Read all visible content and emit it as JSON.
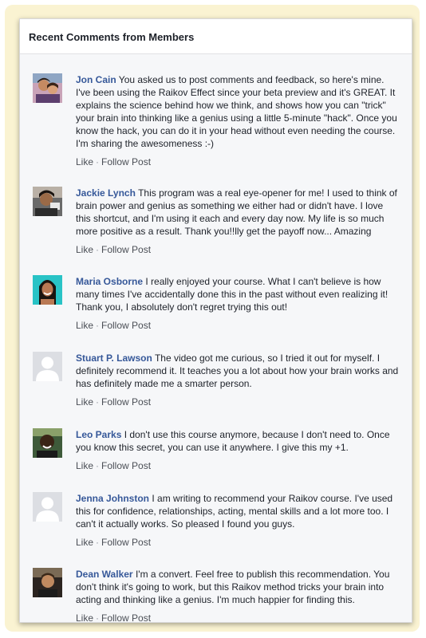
{
  "header": {
    "title": "Recent Comments from Members"
  },
  "actions": {
    "like": "Like",
    "separator": "·",
    "follow": "Follow Post"
  },
  "comments": [
    {
      "author": "Jon Cain",
      "text": "You asked us to post comments and feedback, so here's mine. I've been using the Raikov Effect since your beta preview and it's GREAT. It explains the science behind how we think, and shows how you can \"trick\" your brain into thinking like a genius using a little 5-minute \"hack\". Once you know the hack, you can do it in your head without even needing the course. I'm sharing the awesomeness :-)"
    },
    {
      "author": "Jackie Lynch",
      "text": "This program was a real eye-opener for me! I used to think of brain power and genius as something we either had or didn't have. I love this shortcut, and I'm using it each and every day now. My life is so much more positive as a result. Thank you!!lly get the payoff now... Amazing"
    },
    {
      "author": "Maria Osborne",
      "text": "I really enjoyed your course. What I can't believe is how many times I've accidentally done this in the past without even realizing it! Thank you, I absolutely don't regret trying this out!"
    },
    {
      "author": "Stuart P. Lawson",
      "text": "The video got me curious, so I tried it out for myself. I definitely recommend it. It teaches you a lot about how your brain works and has definitely made me a smarter person."
    },
    {
      "author": "Leo Parks",
      "text": "I don't use this course anymore, because I don't need to. Once you know this secret, you can use it anywhere. I give this my +1."
    },
    {
      "author": "Jenna Johnston",
      "text": "I am writing to recommend your Raikov course. I've used this for confidence, relationships, acting, mental skills and a lot more too. I can't it actually works. So pleased I found you guys."
    },
    {
      "author": "Dean Walker",
      "text": "I'm a convert. Feel free to publish this recommendation. You don't think it's going to work, but this Raikov method tricks your brain into acting and thinking like a genius. I'm much happier for finding this."
    }
  ]
}
